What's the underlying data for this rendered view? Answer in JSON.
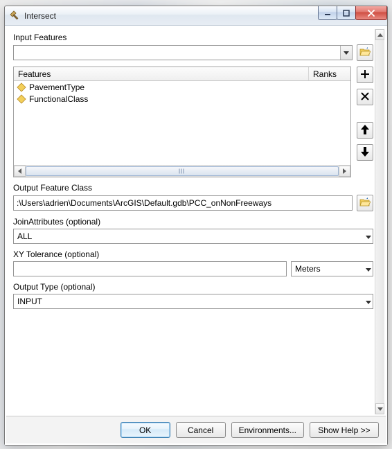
{
  "window": {
    "title": "Intersect"
  },
  "input_features": {
    "label": "Input Features",
    "value": ""
  },
  "features_table": {
    "col_features": "Features",
    "col_ranks": "Ranks",
    "rows": [
      {
        "name": "PavementType",
        "rank": ""
      },
      {
        "name": "FunctionalClass",
        "rank": ""
      }
    ]
  },
  "output_fc": {
    "label": "Output Feature Class",
    "value": ":\\Users\\adrien\\Documents\\ArcGIS\\Default.gdb\\PCC_onNonFreeways"
  },
  "join_attrs": {
    "label": "JoinAttributes (optional)",
    "value": "ALL"
  },
  "xy_tol": {
    "label": "XY Tolerance (optional)",
    "value": "",
    "unit": "Meters"
  },
  "output_type": {
    "label": "Output Type (optional)",
    "value": "INPUT"
  },
  "footer": {
    "ok": "OK",
    "cancel": "Cancel",
    "env": "Environments...",
    "help": "Show Help >>"
  },
  "icons": {
    "browse": "folder-open-icon",
    "add": "plus-icon",
    "remove": "x-icon",
    "up": "arrow-up-icon",
    "down": "arrow-down-icon"
  }
}
